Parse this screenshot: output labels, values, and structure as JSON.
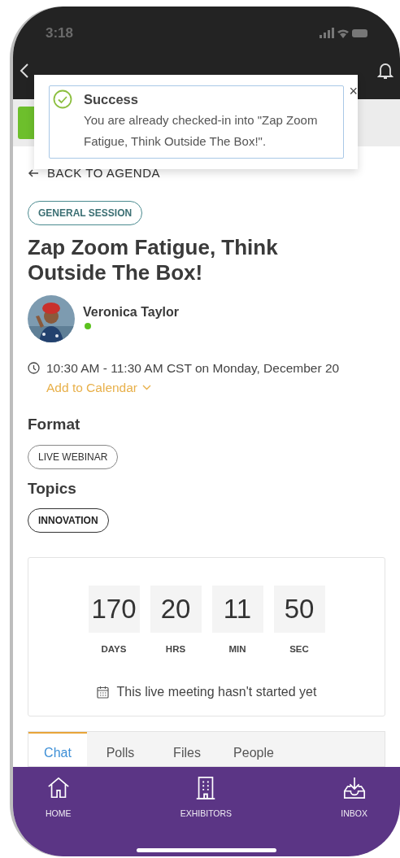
{
  "status_bar": {
    "time": "3:18"
  },
  "toast": {
    "title": "Success",
    "message": "You are already checked-in into \"Zap Zoom Fatigue, Think Outside The Box!\".",
    "close": "×"
  },
  "back_link": "BACK TO AGENDA",
  "session_type": "GENERAL SESSION",
  "title": "Zap Zoom Fatigue, Think Outside The Box!",
  "speaker": {
    "name": "Veronica Taylor",
    "online": true
  },
  "schedule": {
    "time": "10:30 AM - 11:30 AM CST on Monday, December 20",
    "add_to_calendar": "Add to Calendar"
  },
  "format": {
    "heading": "Format",
    "tags": [
      "LIVE WEBINAR"
    ]
  },
  "topics": {
    "heading": "Topics",
    "tags": [
      "INNOVATION"
    ]
  },
  "countdown": {
    "units": [
      {
        "value": "170",
        "label": "DAYS"
      },
      {
        "value": "20",
        "label": "HRS"
      },
      {
        "value": "11",
        "label": "MIN"
      },
      {
        "value": "50",
        "label": "SEC"
      }
    ],
    "message": "This live meeting hasn't started yet"
  },
  "tabs": [
    {
      "label": "Chat",
      "selected": true
    },
    {
      "label": "Polls",
      "selected": false
    },
    {
      "label": "Files",
      "selected": false
    },
    {
      "label": "People",
      "selected": false
    }
  ],
  "bottom_nav": [
    {
      "label": "HOME",
      "kind": "home"
    },
    {
      "label": "EXHIBITORS",
      "kind": "building"
    },
    {
      "label": "INBOX",
      "kind": "inbox"
    }
  ]
}
